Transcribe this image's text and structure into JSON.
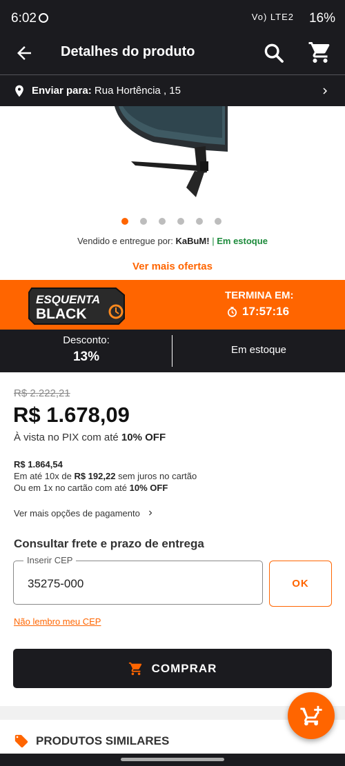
{
  "status_bar": {
    "time": "6:02",
    "network": "Vo) LTE2",
    "battery": "16%"
  },
  "app_bar": {
    "title": "Detalhes do produto"
  },
  "shipping": {
    "label": "Enviar para:",
    "address": "Rua Hortência , 15"
  },
  "gallery": {
    "total_images": 6,
    "active_index": 0
  },
  "seller": {
    "prefix": "Vendido e entregue por:",
    "name": "KaBuM!",
    "separator": "|",
    "stock": "Em estoque"
  },
  "more_offers": "Ver mais ofertas",
  "promo": {
    "logo_line1": "ESQUENTA",
    "logo_line2": "BLACK",
    "ends_label": "TERMINA EM:",
    "timer": "17:57:16",
    "colors": {
      "banner": "#ff6500"
    }
  },
  "discount": {
    "label": "Desconto:",
    "percent": "13%",
    "stock": "Em estoque"
  },
  "pricing": {
    "old_price": "R$ 2.222,21",
    "price": "R$ 1.678,09",
    "pix_text": "À vista no PIX com até",
    "pix_off": "10% OFF",
    "installment_total": "R$ 1.864,54",
    "installment_prefix": "Em até 10x de",
    "installment_value": "R$ 192,22",
    "installment_suffix": "sem juros no cartão",
    "one_x_text": "Ou em 1x no cartão com até",
    "one_x_off": "10% OFF",
    "more_payment": "Ver mais opções de pagamento"
  },
  "freight": {
    "title": "Consultar frete e prazo de entrega",
    "cep_label": "Inserir CEP",
    "cep_value": "35275-000",
    "ok_label": "OK",
    "forgot_cep": "Não lembro meu CEP"
  },
  "buy_button": "COMPRAR",
  "similar_products": "PRODUTOS SIMILARES",
  "colors": {
    "accent": "#ff6500",
    "dark": "#1b1b1f",
    "stock_green": "#1b8a3a"
  }
}
